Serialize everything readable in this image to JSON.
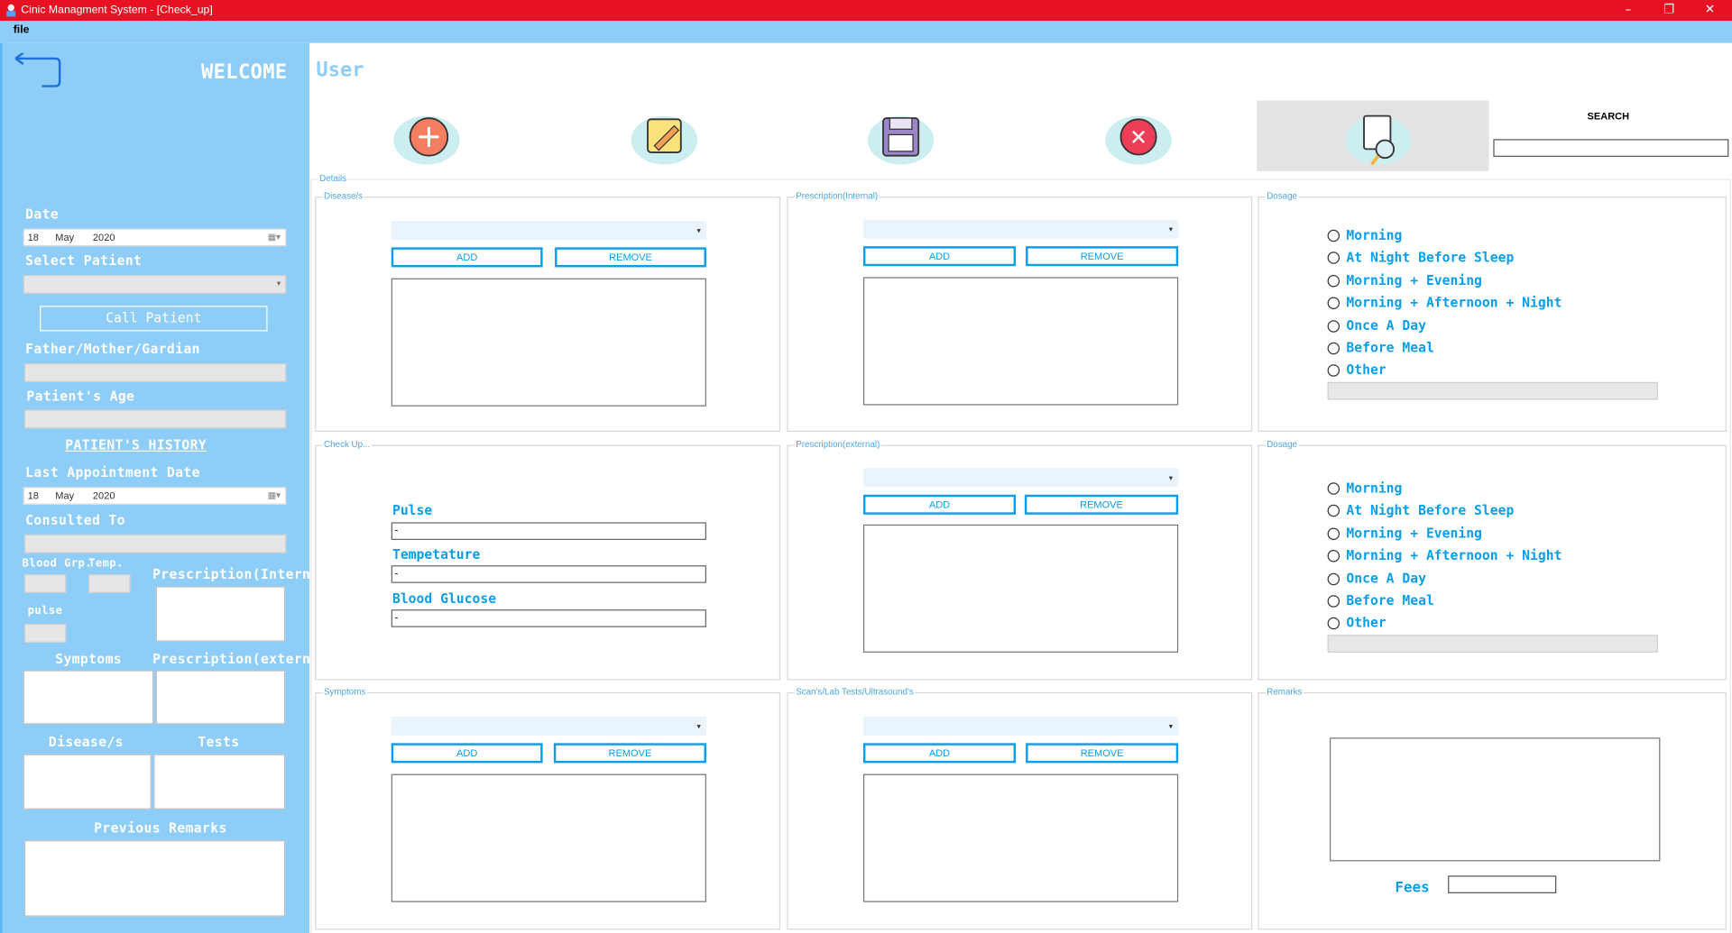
{
  "window": {
    "title": "Cinic Managment System - [Check_up]",
    "minimize_glyph": "–",
    "restore_glyph": "❐",
    "close_glyph": "✕"
  },
  "menu": {
    "file": "file"
  },
  "sidebar": {
    "welcome": "WELCOME",
    "date_label": "Date",
    "date": {
      "day": "18",
      "month": "May",
      "year": "2020"
    },
    "select_patient_label": "Select Patient",
    "call_patient_button": "Call Patient",
    "guardian_label": "Father/Mother/Gardian",
    "age_label": "Patient's Age",
    "history_title": "PATIENT'S HISTORY",
    "last_appointment_label": "Last Appointment Date",
    "last_date": {
      "day": "18",
      "month": "May",
      "year": "2020"
    },
    "consulted_label": "Consulted To",
    "blood_group_label": "Blood Grp.",
    "temp_label": "Temp.",
    "prescription_internal_label": "Prescription(Internal)",
    "pulse_label": "pulse",
    "symptoms_label": "Symptoms",
    "prescription_external_label": "Prescription(external)",
    "disease_label": "Disease/s",
    "tests_label": "Tests",
    "previous_remarks_label": "Previous Remarks"
  },
  "main": {
    "user_label": "User",
    "search_label": "SEARCH",
    "details_title": "Details",
    "groups": {
      "disease": "Disease/s",
      "prescription_internal": "Prescription(Internal)",
      "dosage1": "Dosage",
      "checkup": "Check Up...",
      "prescription_external": "Prescription(external)",
      "dosage2": "Dosage",
      "symptoms": "Symptoms",
      "scans": "Scan's/Lab Tests/Ultrasound's",
      "remarks": "Remarks"
    },
    "add_label": "ADD",
    "remove_label": "REMOVE",
    "dosage_options": [
      "Morning",
      "At Night Before Sleep",
      "Morning + Evening",
      "Morning + Afternoon + Night",
      "Once A Day",
      "Before Meal",
      "Other"
    ],
    "checkup": {
      "pulse_label": "Pulse",
      "pulse_value": "-",
      "temperature_label": "Tempetature",
      "temperature_value": "-",
      "glucose_label": "Blood Glucose",
      "glucose_value": "-"
    },
    "fees_label": "Fees"
  },
  "colors": {
    "titlebar": "#e81123",
    "sidebar": "#8dcdf7",
    "accent": "#0a9ee9"
  }
}
